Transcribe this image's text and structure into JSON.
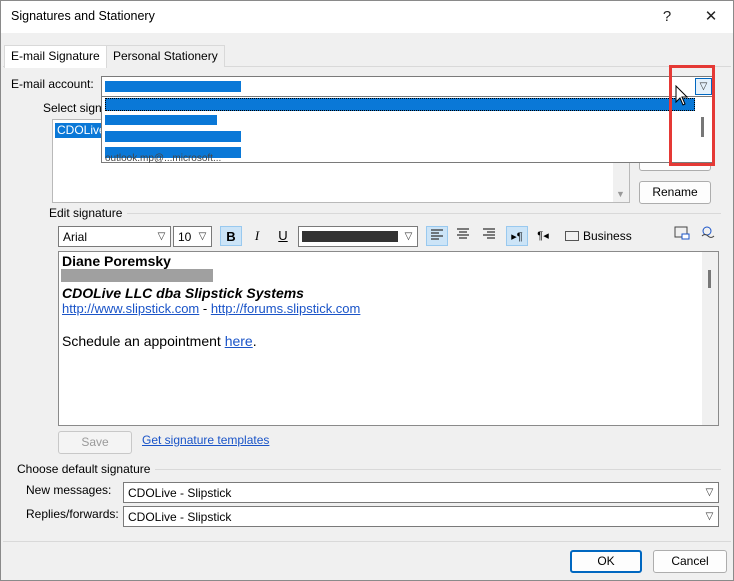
{
  "window": {
    "title": "Signatures and Stationery",
    "help_glyph": "?",
    "close_glyph": "✕"
  },
  "tabs": [
    {
      "label": "E-mail Signature"
    },
    {
      "label": "Personal Stationery"
    }
  ],
  "email_account": {
    "label": "E-mail account:"
  },
  "select_signature": {
    "label": "Select signa",
    "items": [
      "CDOLive"
    ]
  },
  "hidden_item_fragment": "outlook.mp@...microsoft...",
  "buttons": {
    "rename": "Rename",
    "save": "Save",
    "ok": "OK",
    "cancel": "Cancel",
    "partial_top": "D"
  },
  "edit_signature": {
    "label": "Edit signature"
  },
  "toolbar": {
    "font": "Arial",
    "size": "10",
    "bold": "B",
    "italic": "I",
    "underline": "U",
    "business_card": "Business Card"
  },
  "signature": {
    "name": "Diane Poremsky",
    "company": "CDOLive LLC dba Slipstick Systems",
    "link1": "http://www.slipstick.com",
    "sep": " - ",
    "link2": "http://forums.slipstick.com",
    "appt_text": "Schedule an appointment ",
    "appt_link": "here",
    "appt_end": "."
  },
  "templates_link": "Get signature templates",
  "default_signature": {
    "group_label": "Choose default signature",
    "new_label": "New messages:",
    "new_value": "CDOLive - Slipstick",
    "replies_label": "Replies/forwards:",
    "replies_value": "CDOLive - Slipstick"
  },
  "colors": {
    "highlight": "#0a78d7",
    "annotation_red": "#e53935",
    "link": "#1a54c8"
  }
}
